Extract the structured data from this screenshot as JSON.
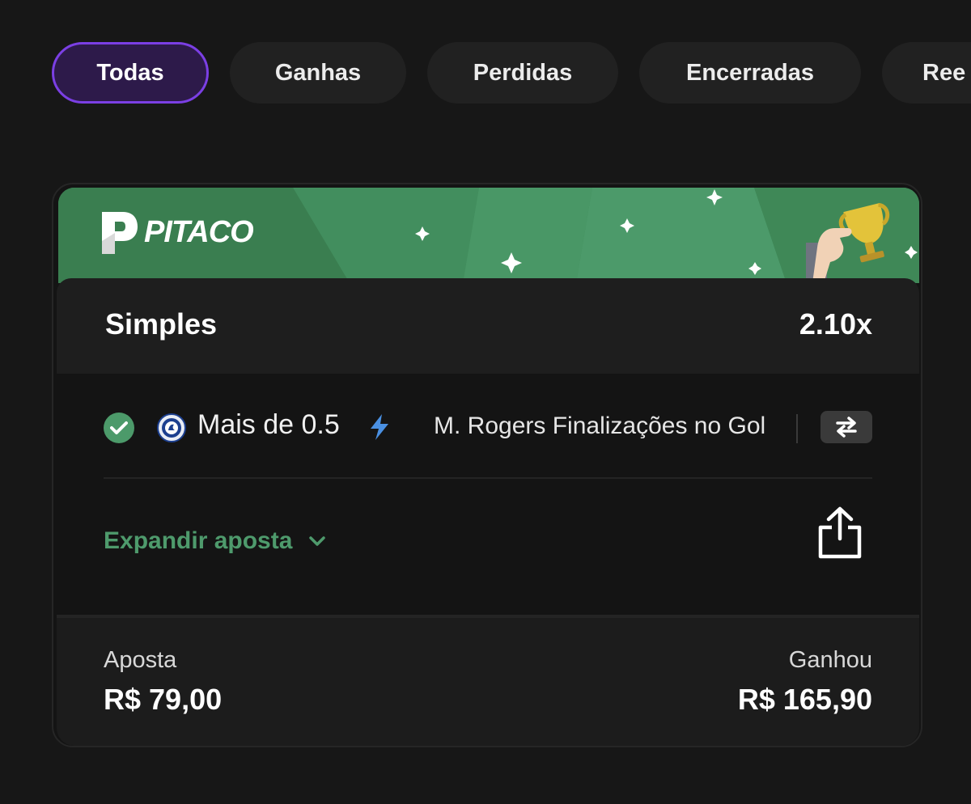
{
  "tabs": [
    {
      "label": "Todas",
      "active": true
    },
    {
      "label": "Ganhas",
      "active": false
    },
    {
      "label": "Perdidas",
      "active": false
    },
    {
      "label": "Encerradas",
      "active": false
    },
    {
      "label": "Ree",
      "active": false
    }
  ],
  "banner": {
    "brand": "PITACO",
    "logo_icon": "pitaco-p-logo-icon",
    "trophy_icon": "trophy-hand-icon",
    "background_color": "#3f8a57"
  },
  "bet": {
    "type": "Simples",
    "odds": "2.10x",
    "selection": {
      "status_icon": "check-circle-icon",
      "team_icon": "chelsea-crest-icon",
      "market": "Mais de 0.5",
      "boost_icon": "lightning-icon",
      "description": "M. Rogers Finalizações no Gol",
      "swap_icon": "swap-arrows-icon"
    },
    "expand_label": "Expandir aposta",
    "share_icon": "share-icon",
    "stake_label": "Aposta",
    "stake_value": "R$ 79,00",
    "result_label": "Ganhou",
    "result_value": "R$ 165,90"
  },
  "colors": {
    "accent_purple": "#7b3fe4",
    "success_green": "#4c9a6a",
    "boost_blue": "#4a90e2"
  }
}
